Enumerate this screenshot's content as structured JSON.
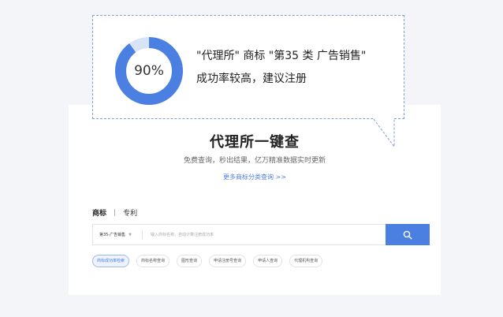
{
  "colors": {
    "accent": "#4b7fe1",
    "gauge_track": "#d9e3f6",
    "link": "#4d7fe0"
  },
  "hero": {
    "title": "代理所一键查",
    "subtitle": "免费查询，秒出结果，亿万精准数据实时更新",
    "more_link": "更多商标分类查询 >>"
  },
  "tabs": [
    {
      "label": "商标",
      "active": true
    },
    {
      "label": "专利",
      "active": false
    }
  ],
  "tab_separator": "|",
  "search": {
    "category": "第35-广告销售",
    "placeholder": "输入商标名称，自动计算注册成功率",
    "button_icon": "search-icon"
  },
  "quick_links": [
    {
      "label": "商标成功率检索",
      "active": true
    },
    {
      "label": "商标名称查询",
      "active": false
    },
    {
      "label": "图形查询",
      "active": false
    },
    {
      "label": "申请注册号查询",
      "active": false
    },
    {
      "label": "申请人查询",
      "active": false
    },
    {
      "label": "代理机构查询",
      "active": false
    }
  ],
  "result_bubble": {
    "success_rate": 90,
    "success_rate_label": "90%",
    "line1": "\"代理所\" 商标 \"第35 类 广告销售\"",
    "line2": "成功率较高，建议注册"
  }
}
